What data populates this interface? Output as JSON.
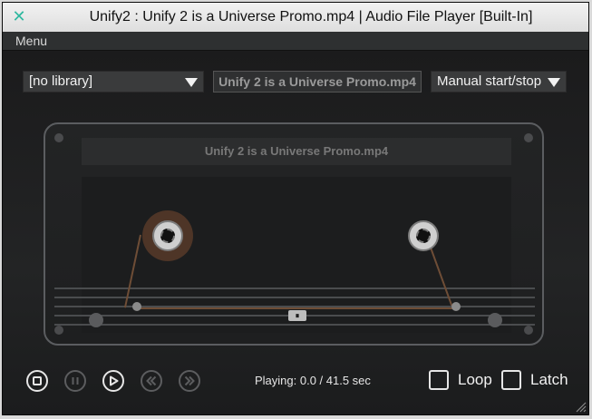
{
  "window": {
    "title": "Unify2 : Unify 2 is a Universe Promo.mp4 | Audio File Player [Built-In]",
    "close_icon": "close-icon"
  },
  "menubar": {
    "menu_label": "Menu"
  },
  "controls": {
    "library_select": "[no library]",
    "file_display": "Unify 2 is a Universe Promo.mp4",
    "mode_select": "Manual start/stop"
  },
  "cassette": {
    "label": "Unify 2 is a Universe Promo.mp4",
    "center_glyph": "⏸"
  },
  "transport": {
    "buttons": [
      {
        "name": "stop",
        "icon": "stop-icon",
        "enabled": true
      },
      {
        "name": "pause",
        "icon": "pause-icon",
        "enabled": false
      },
      {
        "name": "play",
        "icon": "play-icon",
        "enabled": true
      },
      {
        "name": "rewind",
        "icon": "rewind-icon",
        "enabled": false
      },
      {
        "name": "fast-forward",
        "icon": "fast-forward-icon",
        "enabled": false
      }
    ],
    "status": "Playing: 0.0 / 41.5 sec"
  },
  "options": {
    "loop_label": "Loop",
    "latch_label": "Latch",
    "loop_checked": false,
    "latch_checked": false
  },
  "colors": {
    "accent": "#2fb8a0",
    "tape": "#6e4d36",
    "panel_bg": "#1d1e1f"
  }
}
